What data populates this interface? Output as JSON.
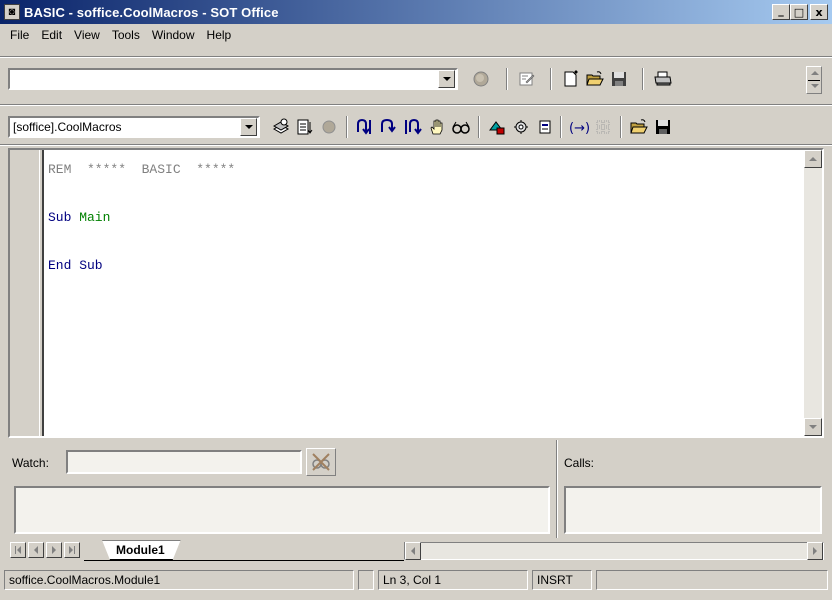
{
  "window": {
    "title": "BASIC - soffice.CoolMacros - SOT Office",
    "minimize": "_",
    "maximize": "□",
    "close": "x"
  },
  "menu": {
    "items": [
      {
        "label": "File"
      },
      {
        "label": "Edit"
      },
      {
        "label": "View"
      },
      {
        "label": "Tools"
      },
      {
        "label": "Window"
      },
      {
        "label": "Help"
      }
    ]
  },
  "toolbar1": {
    "url_value": "",
    "icons": [
      "stop-icon",
      "edit-file-icon",
      "new-document-icon",
      "open-folder-icon",
      "save-icon",
      "print-icon"
    ]
  },
  "toolbar2": {
    "library_value": "[soffice].CoolMacros",
    "icons": [
      "compile-icon",
      "run-icon",
      "stop-macro-icon",
      "step-into-icon",
      "step-over-icon",
      "step-out-icon",
      "breakpoint-hand-icon",
      "enable-watch-icon",
      "macros-icon",
      "modules-icon",
      "dialog-icon",
      "find-parentheses-icon",
      "controls-icon",
      "insert-source-icon",
      "save-source-icon"
    ]
  },
  "editor": {
    "lines": [
      {
        "text": "REM  *****  BASIC  *****",
        "color": "#808080"
      },
      {
        "text": "",
        "color": "#000000"
      },
      {
        "text": "Sub",
        "color": "#000080",
        "rest": " Main",
        "rest_color": "#008000"
      },
      {
        "text": "",
        "color": "#000000"
      },
      {
        "text": "End Sub",
        "color": "#000080"
      }
    ]
  },
  "watch": {
    "label": "Watch:",
    "input_value": ""
  },
  "calls": {
    "label": "Calls:"
  },
  "tabs": {
    "items": [
      {
        "label": "Module1",
        "active": true
      }
    ]
  },
  "status": {
    "module": "soffice.CoolMacros.Module1",
    "position": "Ln 3, Col 1",
    "mode": "INSRT",
    "extra": ""
  },
  "colors": {
    "title_start": "#0a246a",
    "title_end": "#a6caf0",
    "comment": "#808080",
    "keyword": "#000080",
    "identifier": "#008000",
    "stop_red": "#c80000"
  }
}
